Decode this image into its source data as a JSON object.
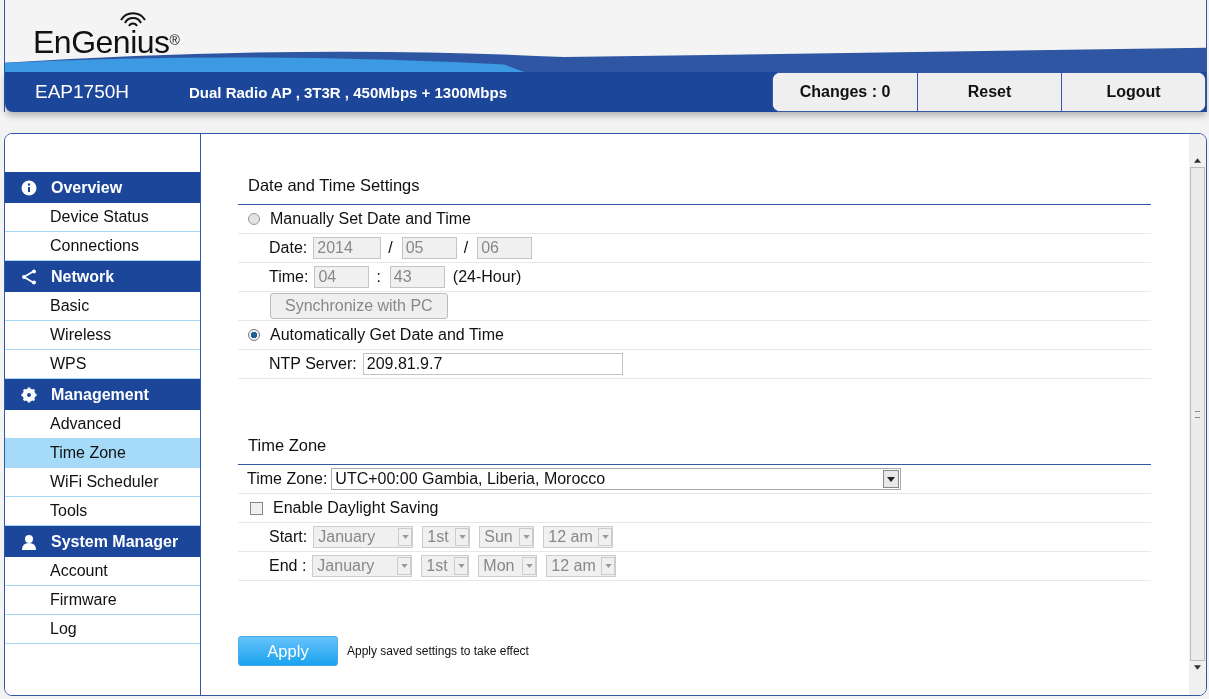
{
  "header": {
    "logo": "EnGenius",
    "logo_mark": "®",
    "model": "EAP1750H",
    "description": "Dual Radio AP , 3T3R , 450Mbps + 1300Mbps",
    "buttons": [
      "Changes : 0",
      "Reset",
      "Logout"
    ]
  },
  "sidebar": {
    "groups": [
      {
        "title": "Overview",
        "items": [
          {
            "label": "Device Status",
            "selected": false
          },
          {
            "label": "Connections",
            "selected": false
          }
        ]
      },
      {
        "title": "Network",
        "items": [
          {
            "label": "Basic",
            "selected": false
          },
          {
            "label": "Wireless",
            "selected": false
          },
          {
            "label": "WPS",
            "selected": false
          }
        ]
      },
      {
        "title": "Management",
        "items": [
          {
            "label": "Advanced",
            "selected": false
          },
          {
            "label": "Time Zone",
            "selected": true
          },
          {
            "label": "WiFi Scheduler",
            "selected": false
          },
          {
            "label": "Tools",
            "selected": false
          }
        ]
      },
      {
        "title": "System Manager",
        "items": [
          {
            "label": "Account",
            "selected": false
          },
          {
            "label": "Firmware",
            "selected": false
          },
          {
            "label": "Log",
            "selected": false
          }
        ]
      }
    ]
  },
  "date_time": {
    "title": "Date and Time Settings",
    "modes": [
      {
        "label": "Manually Set Date and Time",
        "selected": false
      },
      {
        "label": "Automatically Get Date and Time",
        "selected": true
      }
    ],
    "date": {
      "label": "Date:",
      "fields": [
        "2014",
        "05",
        "06"
      ],
      "separators": [
        "/",
        "/"
      ]
    },
    "time": {
      "label": "Time:",
      "fields": [
        "04",
        "43"
      ],
      "separators": [
        ":"
      ],
      "note": "(24-Hour)"
    },
    "sync_button": "Synchronize with PC",
    "ntp": {
      "label": "NTP Server:",
      "value": "209.81.9.7"
    }
  },
  "time_zone": {
    "title": "Time Zone",
    "label": "Time Zone:",
    "value": "UTC+00:00 Gambia, Liberia, Morocco",
    "daylight": {
      "label": "Enable Daylight Saving",
      "checked": false
    },
    "ranges": [
      {
        "label": "Start:",
        "selects": [
          "January",
          "1st",
          "Sun",
          "12 am"
        ]
      },
      {
        "label": "End :",
        "selects": [
          "January",
          "1st",
          "Mon",
          "12 am"
        ]
      }
    ]
  },
  "apply": {
    "button": "Apply",
    "note": "Apply saved settings to take effect"
  }
}
